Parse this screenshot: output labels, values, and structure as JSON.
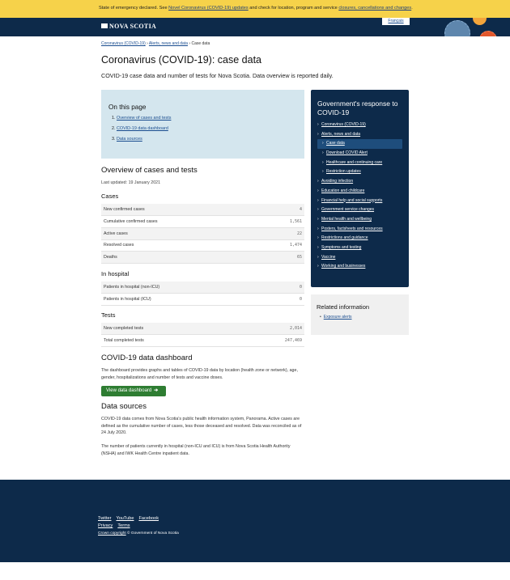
{
  "alert": {
    "text_before": "State of emergency declared. See ",
    "link1": "Novel Coronavirus (COVID-19) updates",
    "text_middle": " and check for location, program and service ",
    "link2": "closures, cancellations and changes",
    "text_after": "."
  },
  "header": {
    "logo": "NOVA SCOTIA",
    "language_link": "Français"
  },
  "breadcrumb": {
    "item1": "Coronavirus (COVID-19)",
    "sep": " › ",
    "item2": "Alerts, news and data",
    "current": "Case data"
  },
  "page": {
    "title": "Coronavirus (COVID-19): case data",
    "lead": "COVID-19 case data and number of tests for Nova Scotia. Data overview is reported daily."
  },
  "toc": {
    "heading": "On this page",
    "items": [
      {
        "num": "1.",
        "label": "Overview of cases and tests"
      },
      {
        "num": "2.",
        "label": "COVID-19 data dashboard"
      },
      {
        "num": "3.",
        "label": "Data sources"
      }
    ]
  },
  "overview": {
    "heading": "Overview of cases and tests",
    "updated": "Last updated: 19 January 2021",
    "cases": {
      "heading": "Cases",
      "rows": [
        {
          "label": "New confirmed cases",
          "value": "4"
        },
        {
          "label": "Cumulative confirmed cases",
          "value": "1,561"
        },
        {
          "label": "Active cases",
          "value": "22"
        },
        {
          "label": "Resolved cases",
          "value": "1,474"
        },
        {
          "label": "Deaths",
          "value": "65"
        }
      ]
    },
    "hospital": {
      "heading": "In hospital",
      "rows": [
        {
          "label": "Patients in hospital (non-ICU)",
          "value": "0"
        },
        {
          "label": "Patients in hospital (ICU)",
          "value": "0"
        }
      ]
    },
    "tests": {
      "heading": "Tests",
      "rows": [
        {
          "label": "New completed tests",
          "value": "2,014"
        },
        {
          "label": "Total completed tests",
          "value": "247,469"
        }
      ]
    }
  },
  "dashboard": {
    "heading": "COVID-19 data dashboard",
    "text": "The dashboard provides graphs and tables of COVID-19 data by location (health zone or network), age, gender, hospitalizations and number of tests and vaccine doses.",
    "button": "View data dashboard",
    "button_icon": "arrow-right-icon"
  },
  "sources": {
    "heading": "Data sources",
    "para1": "COVID-19 data comes from Nova Scotia's public health information system, Panorama. Active cases are defined as the cumulative number of cases, less those deceased and resolved. Data was reconciled as of 24 July 2020.",
    "para2": "The number of patients currently in hospital (non-ICU and ICU) is from Nova Scotia Health Authority (NSHA) and IWK Health Centre inpatient data."
  },
  "sidebar": {
    "heading": "Government's response to COVID-19",
    "items": [
      {
        "label": "Coronavirus (COVID-19)",
        "level": 0
      },
      {
        "label": "Alerts, news and data",
        "level": 0
      },
      {
        "label": "Case data",
        "level": 1,
        "active": true
      },
      {
        "label": "Download COVID Alert",
        "level": 1
      },
      {
        "label": "Healthcare and continuing care",
        "level": 1
      },
      {
        "label": "Restriction updates",
        "level": 1
      },
      {
        "label": "Avoiding infection",
        "level": 0
      },
      {
        "label": "Education and childcare",
        "level": 0
      },
      {
        "label": "Financial help and social supports",
        "level": 0
      },
      {
        "label": "Government service changes",
        "level": 0
      },
      {
        "label": "Mental health and wellbeing",
        "level": 0
      },
      {
        "label": "Posters, factsheets and resources",
        "level": 0
      },
      {
        "label": "Restrictions and guidance",
        "level": 0
      },
      {
        "label": "Symptoms and testing",
        "level": 0
      },
      {
        "label": "Vaccine",
        "level": 0
      },
      {
        "label": "Working and businesses",
        "level": 0
      }
    ]
  },
  "related": {
    "heading": "Related information",
    "items": [
      "Exposure alerts"
    ]
  },
  "footer": {
    "social": [
      "Twitter",
      "YouTube",
      "Facebook"
    ],
    "legal": [
      "Privacy",
      "Terms"
    ],
    "copyright_link": "Crown copyright",
    "copyright_text": " © Government of Nova Scotia"
  },
  "colors": {
    "alert_bg": "#f6d24a",
    "navy": "#0d2a4a",
    "toc_bg": "#d4e6ee",
    "button_green": "#2e7d32"
  }
}
